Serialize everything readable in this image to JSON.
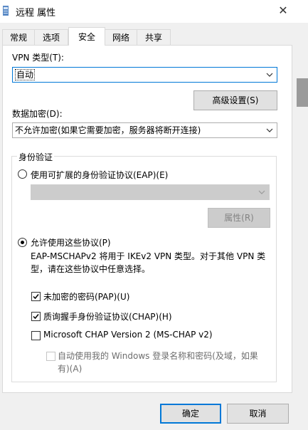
{
  "window": {
    "title": "远程 属性",
    "close_glyph": "✕"
  },
  "tabs": [
    {
      "label": "常规"
    },
    {
      "label": "选项"
    },
    {
      "label": "安全"
    },
    {
      "label": "网络"
    },
    {
      "label": "共享"
    }
  ],
  "vpn_type": {
    "label": "VPN 类型(T):",
    "value": "自动"
  },
  "advanced_button": {
    "label": "高级设置(S)"
  },
  "encryption": {
    "label": "数据加密(D):",
    "value": "不允许加密(如果它需要加密，服务器将断开连接)"
  },
  "auth": {
    "group_label": "身份验证",
    "eap_radio": {
      "label": "使用可扩展的身份验证协议(EAP)(E)",
      "checked": false
    },
    "eap_combo": {
      "value": ""
    },
    "properties_button": {
      "label": "属性(R)"
    },
    "allow_radio": {
      "label": "允许使用这些协议(P)",
      "checked": true
    },
    "description": "EAP-MSCHAPv2 将用于 IKEv2 VPN 类型。对于其他 VPN 类型，请在这些协议中任意选择。",
    "pap": {
      "label": "未加密的密码(PAP)(U)",
      "checked": true
    },
    "chap": {
      "label": "质询握手身份验证协议(CHAP)(H)",
      "checked": true
    },
    "mschap": {
      "label": "Microsoft CHAP Version 2 (MS-CHAP v2)",
      "checked": false
    },
    "autologon": {
      "label": "自动使用我的 Windows 登录名称和密码(及域，如果有)(A)",
      "checked": false
    }
  },
  "ok_button": {
    "label": "确定"
  },
  "cancel_button": {
    "label": "取消"
  },
  "colors": {
    "accent": "#0078d7",
    "window_bg": "#f0f0f0",
    "panel_bg": "#ffffff"
  }
}
